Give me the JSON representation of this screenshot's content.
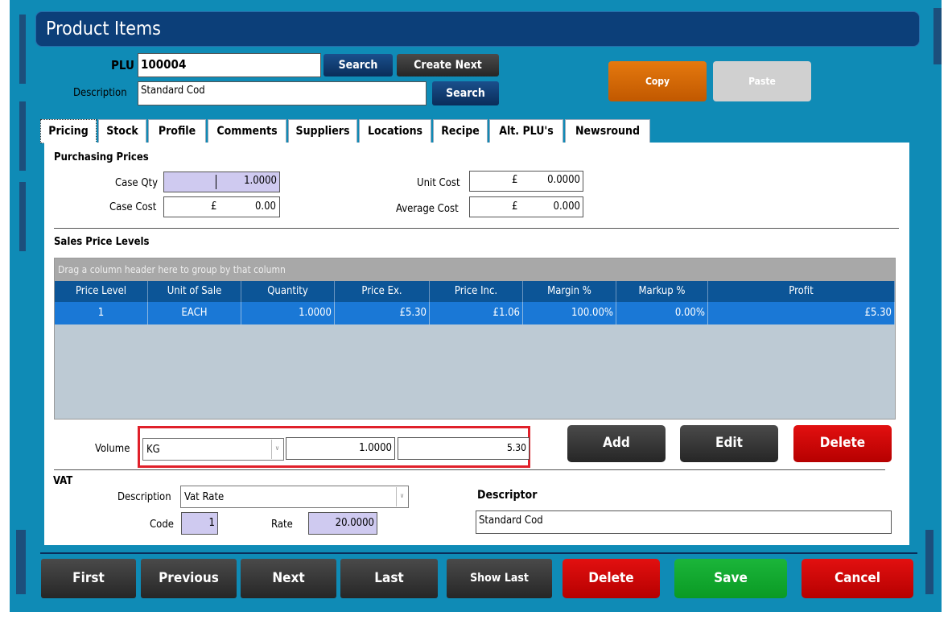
{
  "window": {
    "title": "Product Items"
  },
  "header": {
    "plu_label": "PLU",
    "plu_value": "100004",
    "search1_label": "Search",
    "create_next_label": "Create Next",
    "description_label": "Description",
    "description_value": "Standard Cod",
    "search2_label": "Search",
    "copy_label": "Copy",
    "paste_label": "Paste"
  },
  "tabs": [
    {
      "label": "Pricing"
    },
    {
      "label": "Stock"
    },
    {
      "label": "Profile"
    },
    {
      "label": "Comments"
    },
    {
      "label": "Suppliers"
    },
    {
      "label": "Locations"
    },
    {
      "label": "Recipe"
    },
    {
      "label": "Alt. PLU's"
    },
    {
      "label": "Newsround"
    }
  ],
  "purchasing": {
    "section_title": "Purchasing Prices",
    "case_qty_label": "Case Qty",
    "case_qty_value": "1.0000",
    "case_cost_label": "Case Cost",
    "case_cost_currency": "£",
    "case_cost_value": "0.00",
    "unit_cost_label": "Unit Cost",
    "unit_cost_currency": "£",
    "unit_cost_value": "0.0000",
    "average_cost_label": "Average Cost",
    "average_cost_currency": "£",
    "average_cost_value": "0.000"
  },
  "sales": {
    "section_title": "Sales Price Levels",
    "group_hint": "Drag a column header here to group by that column",
    "columns": [
      "Price Level",
      "Unit of Sale",
      "Quantity",
      "Price Ex.",
      "Price Inc.",
      "Margin %",
      "Markup %",
      "Profit"
    ],
    "rows": [
      [
        "1",
        "EACH",
        "1.0000",
        "£5.30",
        "£1.06",
        "100.00%",
        "0.00%",
        "£5.30"
      ]
    ]
  },
  "volume": {
    "label": "Volume",
    "unit_value": "KG",
    "quantity_value": "1.0000",
    "price_value": "5.30",
    "add_label": "Add",
    "edit_label": "Edit",
    "delete_label": "Delete"
  },
  "vat": {
    "section_title": "VAT",
    "description_label": "Description",
    "description_value": "Vat Rate",
    "code_label": "Code",
    "code_value": "1",
    "rate_label": "Rate",
    "rate_value": "20.0000",
    "descriptor_label": "Descriptor",
    "descriptor_value": "Standard Cod"
  },
  "footer": {
    "first_label": "First",
    "previous_label": "Previous",
    "next_label": "Next",
    "last_label": "Last",
    "show_last_label": "Show Last",
    "delete_label": "Delete",
    "save_label": "Save",
    "cancel_label": "Cancel"
  },
  "colors": {
    "frame": "#0f8bb6",
    "title": "#0c3f79",
    "highlight": "#e0202a",
    "selected_row": "#1a78d6"
  }
}
